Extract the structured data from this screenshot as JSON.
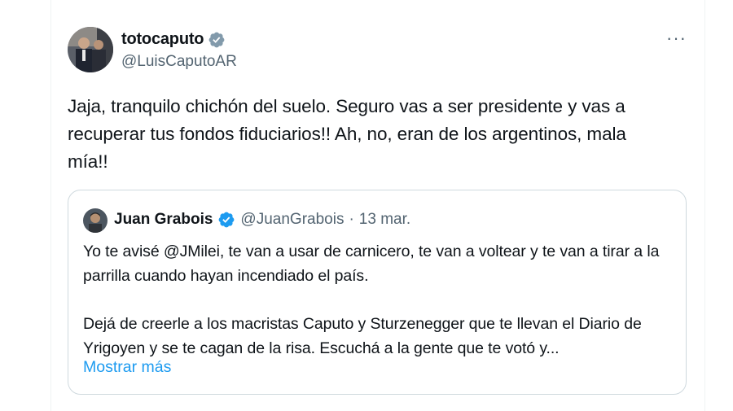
{
  "tweet": {
    "author_name": "totocaputo",
    "author_handle": "@LuisCaputoAR",
    "verified_badge": "verified-badge-gray",
    "more_label": "···",
    "text": "Jaja, tranquilo chichón del suelo. Seguro vas a ser presidente y vas a recuperar tus fondos fiduciarios!! Ah, no, eran de los argentinos, mala mía!!"
  },
  "quote": {
    "author_name": "Juan Grabois",
    "author_handle": "@JuanGrabois",
    "separator": "·",
    "date": "13 mar.",
    "verified_badge": "verified-badge-blue",
    "paragraph1": "Yo te avisé @JMilei, te van a usar de carnicero, te van a voltear y te van a tirar a la parrilla cuando hayan incendiado el país.",
    "paragraph2": "Dejá de creerle a los macristas Caputo y Sturzenegger que te llevan el Diario de Yrigoyen y se te cagan de la risa. Escuchá a la gente que te votó y...",
    "show_more": "Mostrar más"
  },
  "colors": {
    "text": "#0f1419",
    "secondary": "#536471",
    "link": "#1d9bf0",
    "border": "#cfd9de",
    "badge_gray": "#829aab",
    "badge_blue": "#1d9bf0"
  }
}
